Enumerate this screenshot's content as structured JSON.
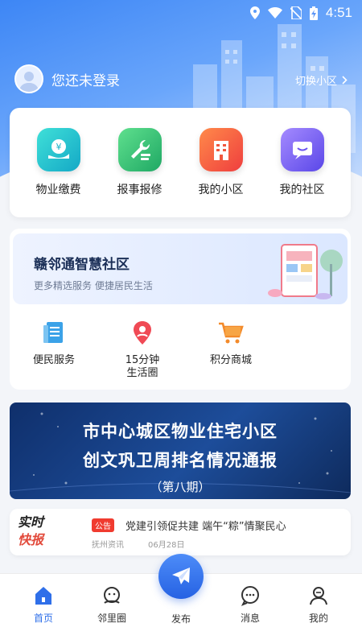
{
  "status_bar": {
    "time": "4:51"
  },
  "user": {
    "login_text": "您还未登录",
    "switch_label": "切换小区"
  },
  "main_grid": [
    {
      "label": "物业缴费",
      "icon": "yuan-hand-icon",
      "color": "#1cc3c4"
    },
    {
      "label": "报事报修",
      "icon": "wrench-icon",
      "color": "#36c27a"
    },
    {
      "label": "我的小区",
      "icon": "building-icon",
      "color": "#f25f3a"
    },
    {
      "label": "我的社区",
      "icon": "chat-icon",
      "color": "#7b5cf5"
    }
  ],
  "smart": {
    "title": "赣邻通智慧社区",
    "subtitle": "更多精选服务 便捷居民生活",
    "services": [
      {
        "label": "便民服务",
        "icon": "document-icon"
      },
      {
        "label_line1": "15分钟",
        "label_line2": "生活圈",
        "icon": "location-pin-icon"
      },
      {
        "label": "积分商城",
        "icon": "cart-icon"
      }
    ]
  },
  "news_banner": {
    "line1": "市中心城区物业住宅小区",
    "line2": "创文巩卫周排名情况通报",
    "line3": "（第八期）"
  },
  "flash": {
    "logo_line1": "实时",
    "logo_line2": "快报",
    "badge": "公告",
    "title": "党建引领促共建 端午“粽”情聚民心",
    "source": "抚州资讯",
    "date": "06月28日"
  },
  "nav": {
    "home": "首页",
    "neighbors": "邻里圈",
    "publish": "发布",
    "messages": "消息",
    "mine": "我的"
  },
  "colors": {
    "primary": "#2f6fe9",
    "header": "#3d86f5",
    "alert": "#f03b2f"
  }
}
